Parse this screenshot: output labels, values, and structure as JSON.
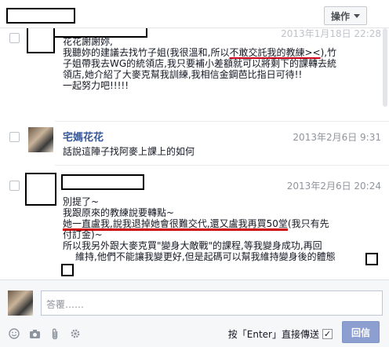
{
  "header": {
    "options_label": "操作"
  },
  "messages": [
    {
      "sender": "",
      "time": "2013年1月18日 22:28",
      "lines": [
        "花花謝謝妳,",
        "我聽妳的建議去找竹子姐(我很溫和,所以不敢交託我的教練><),竹",
        "子姐帶我去WG的統領店,我只要補小差額就可以將剩下的課轉去統",
        "領店,她介紹了大麥克幫我訓練,我相信金鋼芭比指日可待!!",
        "一起努力吧!!!!!"
      ],
      "underline_text": "不敢交託我的教練><"
    },
    {
      "sender": "宅媽花花",
      "time": "2013年2月6日 9:31",
      "lines": [
        "話說這陣子找阿麥上課上的如何"
      ]
    },
    {
      "sender": "",
      "time": "2013年2月6日 20:24",
      "lines": [
        "別提了~",
        "我跟原來的教練說要轉點~",
        "她一直盧我,說我退掉她會很難交代,還又盧我再買50堂(我只有先",
        "付訂金)~",
        "所以我另外跟大麥克買\"變身大敵戰\"的課程,等我變身成功,再回",
        "維持,他們不能讓我變更好,但是起碼可以幫我維持變身後的體態"
      ],
      "underline_text": "她一直盧我,說我退掉她會很難交代,還又盧我再買50堂"
    }
  ],
  "reply": {
    "placeholder": "答覆……",
    "enter_label": "按「Enter」直接傳送",
    "send_label": "回信"
  },
  "icons": {
    "smile": "smile-icon",
    "camera": "camera-icon",
    "attach": "paperclip-icon",
    "gear": "gear-icon",
    "caret": "caret-down-icon"
  },
  "colors": {
    "link": "#365899",
    "send_button": "#8d9fd0",
    "underline": "#d0021b"
  }
}
